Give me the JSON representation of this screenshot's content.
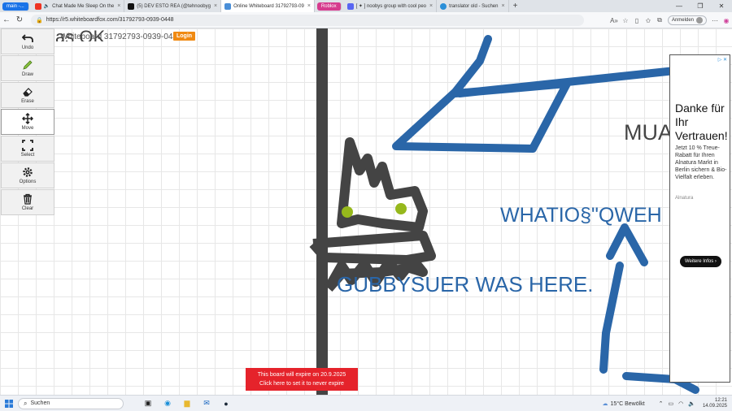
{
  "browser": {
    "tabs": [
      {
        "label": "main -...",
        "kind": "pill"
      },
      {
        "label": "Chat Made Me Sleep On the",
        "kind": "youtube"
      },
      {
        "label": "(5) DEV ESTO REA (@tehnoobyg",
        "kind": "x"
      },
      {
        "label": "Online Whiteboard 31792793-09",
        "kind": "active"
      },
      {
        "label": "Roblox",
        "kind": "roblox"
      },
      {
        "label": "[ ✦ ] noobys group with cool peo",
        "kind": "discord"
      },
      {
        "label": "translator old - Suchen",
        "kind": "bing"
      }
    ],
    "url": "https://r5.whiteboardfox.com/31792793-0939-0448",
    "signin_label": "Anmelden"
  },
  "whiteboard": {
    "title": "Whiteboard 31792793-0939-0448",
    "login_label": "Login",
    "tools": [
      {
        "label": "Undo",
        "icon": "undo-icon"
      },
      {
        "label": "Draw",
        "icon": "pencil-icon"
      },
      {
        "label": "Erase",
        "icon": "eraser-icon"
      },
      {
        "label": "Move",
        "icon": "move-icon"
      },
      {
        "label": "Select",
        "icon": "select-icon"
      },
      {
        "label": "Options",
        "icon": "gear-icon"
      },
      {
        "label": "Clear",
        "icon": "trash-icon"
      }
    ],
    "texts": {
      "partial_top": "as OK",
      "mua": "MUA",
      "whatio": "WHATIO§\"QWEH",
      "gubby": "GUBBYSUER WAS HERE."
    },
    "expire_line1": "This board will expire on 20.9.2025",
    "expire_line2": "Click here to set it to never expire",
    "colors": {
      "ink_blue": "#2a66a8",
      "ink_gray": "#444444",
      "dot_green": "#96b81c",
      "expire_red": "#e5232b",
      "login_orange": "#f08a13"
    }
  },
  "ad": {
    "headline": "Danke für Ihr Vertrauen!",
    "body": "Jetzt 10 % Treue-Rabatt für Ihren Alnatura Markt in Berlin sichern & Bio-Vielfalt erleben.",
    "brand": "Alnatura",
    "cta": "Weitere Infos ›"
  },
  "taskbar": {
    "search_placeholder": "Suchen",
    "weather": "15°C",
    "weather_desc": "Bewölkt",
    "time": "12:21",
    "date": "14.09.2025"
  }
}
